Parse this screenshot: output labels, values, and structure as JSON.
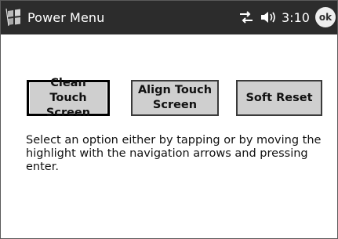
{
  "titlebar": {
    "title": "Power Menu",
    "time": "3:10",
    "ok_label": "ok",
    "icons": {
      "start": "windows-flag-icon",
      "connectivity": "connectivity-arrows-icon",
      "volume": "speaker-volume-icon"
    }
  },
  "buttons": [
    {
      "line1": "Clean Touch",
      "line2": "Screen",
      "selected": true
    },
    {
      "line1": "Align Touch",
      "line2": "Screen",
      "selected": false
    },
    {
      "line1": "Soft Reset",
      "line2": "",
      "selected": false
    }
  ],
  "instructions": "Select an option either by tapping or by moving the highlight with the navigation arrows and pressing enter.",
  "colors": {
    "titlebar_bg": "#2c2c2c",
    "button_bg": "#cfcfcf",
    "button_border": "#3a3a3a",
    "page_bg": "#ffffff"
  }
}
